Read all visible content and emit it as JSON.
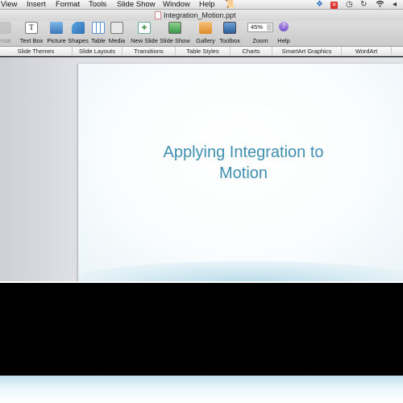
{
  "menubar": {
    "items": [
      "View",
      "Insert",
      "Format",
      "Tools",
      "Slide Show",
      "Window",
      "Help"
    ],
    "script_icon": "script-menu-icon",
    "status_icons": [
      "dropbox-icon",
      "close-icon",
      "time-machine-icon",
      "sync-icon",
      "wifi-icon",
      "volume-icon"
    ]
  },
  "document": {
    "title": "Integration_Motion.ppt"
  },
  "toolbar": {
    "partial_label": "rmat",
    "tools": [
      {
        "label": "Text Box",
        "icon": "text-box-icon"
      },
      {
        "label": "Picture",
        "icon": "picture-icon"
      },
      {
        "label": "Shapes",
        "icon": "shapes-icon"
      },
      {
        "label": "Table",
        "icon": "table-icon"
      },
      {
        "label": "Media",
        "icon": "media-icon"
      },
      {
        "label": "New Slide",
        "icon": "new-slide-icon"
      },
      {
        "label": "Slide Show",
        "icon": "slide-show-icon"
      },
      {
        "label": "Gallery",
        "icon": "gallery-icon"
      },
      {
        "label": "Toolbox",
        "icon": "toolbox-icon"
      },
      {
        "label": "Zoom",
        "icon": "zoom-icon"
      },
      {
        "label": "Help",
        "icon": "help-icon"
      }
    ],
    "zoom_value": "45%"
  },
  "ribbon": {
    "tabs": [
      "Slide Themes",
      "Slide Layouts",
      "Transitions",
      "Table Styles",
      "Charts",
      "SmartArt Graphics",
      "WordArt"
    ]
  },
  "slide": {
    "title_line1": "Applying Integration to",
    "title_line2": "Motion"
  },
  "colors": {
    "title_text": "#3f8fb0",
    "accent_blue": "#bfe0ee"
  }
}
